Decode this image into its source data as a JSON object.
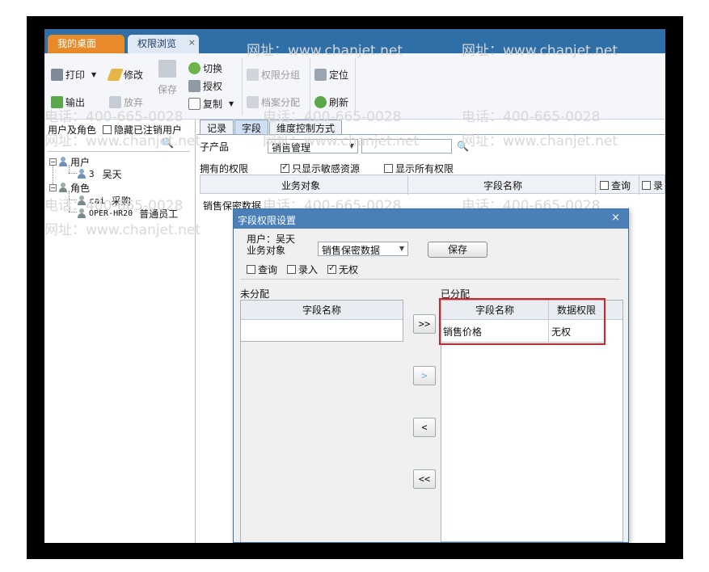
{
  "tabs": {
    "home": "我的桌面",
    "perm": "权限浏览",
    "close": "×"
  },
  "toolbar": {
    "print": "打印",
    "edit": "修改",
    "save": "保存",
    "switch": "切换",
    "authorize": "授权",
    "copy": "复制",
    "perm_group": "权限分组",
    "archive_assign": "档案分配",
    "locate": "定位",
    "refresh": "刷新",
    "export": "输出",
    "discard": "放弃"
  },
  "left": {
    "header": "用户及角色",
    "hide_label": "隐藏已注销用户",
    "tree": {
      "users": "用户",
      "user1_code": "3",
      "user1_name": "吴天",
      "roles": "角色",
      "role1_code": "cai",
      "role1_name": "采购",
      "role2_code": "OPER-HR20",
      "role2_name": "普通员工"
    }
  },
  "main": {
    "subtabs": [
      "记录",
      "字段",
      "维度控制方式"
    ],
    "subproduct_label": "子产品",
    "subproduct_value": "销售管理",
    "owned_perm_label": "拥有的权限",
    "sensitive_only": "只显示敏感资源",
    "show_all": "显示所有权限",
    "col_business": "业务对象",
    "col_field": "字段名称",
    "col_query": "查询",
    "col_entry": "录",
    "row1": "销售保密数据"
  },
  "dialog": {
    "title": "字段权限设置",
    "close": "×",
    "user_label": "用户：吴天",
    "business_label": "业务对象",
    "business_value": "销售保密数据",
    "save_button": "保存",
    "query": "查询",
    "entry": "录入",
    "none": "无权",
    "unassigned_label": "未分配",
    "assigned_label": "已分配",
    "col_field": "字段名称",
    "col_data_perm": "数据权限",
    "assigned_rows": [
      {
        "field": "销售价格",
        "perm": "无权"
      }
    ],
    "btn_all_right": ">>",
    "btn_right": ">",
    "btn_left": "<",
    "btn_all_left": "<<"
  },
  "watermark": {
    "phone": "电话：400-665-0028",
    "site": "网址：www.chanjet.net"
  },
  "colors": {
    "tabbar": "#2f6fa8",
    "home_tab": "#e98a2a",
    "dialog_title": "#4a7fb8",
    "highlight": "#e02020"
  }
}
